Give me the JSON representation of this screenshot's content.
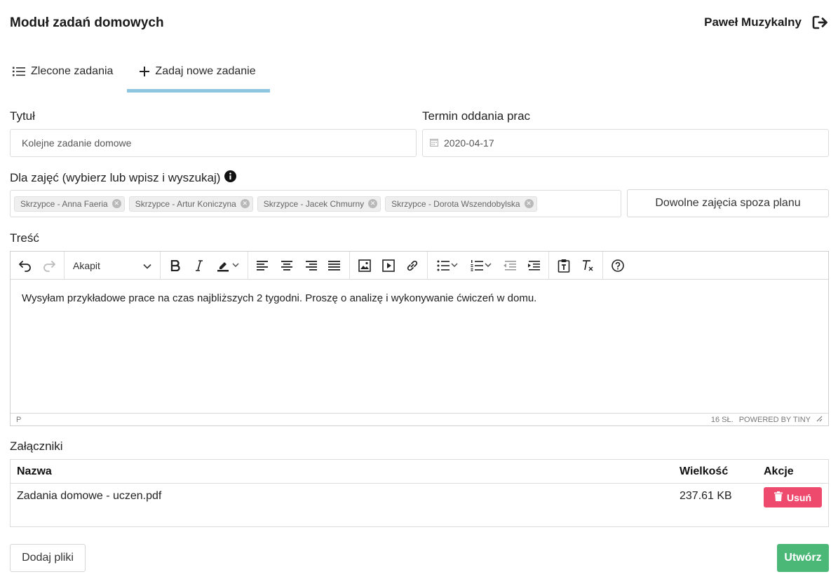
{
  "header": {
    "title": "Moduł zadań domowych",
    "user_name": "Paweł Muzykalny"
  },
  "tabs": [
    {
      "label": "Zlecone zadania",
      "icon": "list-icon",
      "active": false
    },
    {
      "label": "Zadaj nowe zadanie",
      "icon": "plus-icon",
      "active": true
    }
  ],
  "form": {
    "title_label": "Tytuł",
    "title_value": "Kolejne zadanie domowe",
    "deadline_label": "Termin oddania prac",
    "deadline_value": "2020-04-17",
    "classes_label": "Dla zajęć (wybierz lub wpisz i wyszukaj)",
    "classes": [
      "Skrzypce - Anna Faeria",
      "Skrzypce - Artur Koniczyna",
      "Skrzypce - Jacek Chmurny",
      "Skrzypce - Dorota Wszendobylska"
    ],
    "extra_button": "Dowolne zajęcia spoza planu",
    "content_label": "Treść"
  },
  "editor": {
    "format_value": "Akapit",
    "body": "Wysyłam przykładowe prace na czas najbliższych 2 tygodni. Proszę o analizę i wykonywanie ćwiczeń w domu.",
    "status_path": "P",
    "word_count": "16 SŁ.",
    "powered_by": "POWERED BY TINY"
  },
  "attachments": {
    "label": "Załączniki",
    "columns": {
      "name": "Nazwa",
      "size": "Wielkość",
      "actions": "Akcje"
    },
    "rows": [
      {
        "name": "Zadania domowe - uczen.pdf",
        "size": "237.61 KB",
        "action": "Usuń"
      }
    ]
  },
  "actions": {
    "add_files": "Dodaj pliki",
    "create": "Utwórz"
  },
  "colors": {
    "tab_active_underline": "#8ec6e0",
    "delete_button": "#ee4a6d",
    "create_button": "#4bb878"
  }
}
